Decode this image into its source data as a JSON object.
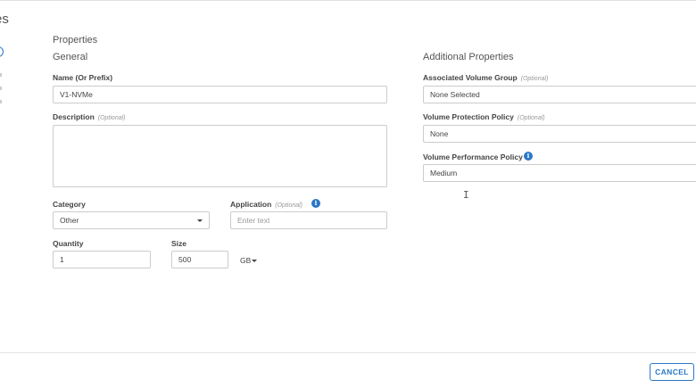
{
  "header": {
    "title_fragment": "es"
  },
  "properties": {
    "title": "Properties",
    "general": {
      "title": "General",
      "name_label": "Name (Or Prefix)",
      "name_value": "V1-NVMe",
      "description_label": "Description",
      "description_optional": "(Optional)",
      "category_label": "Category",
      "category_value": "Other",
      "application_label": "Application",
      "application_optional": "(Optional)",
      "application_placeholder": "Enter text",
      "quantity_label": "Quantity",
      "quantity_value": "1",
      "size_label": "Size",
      "size_value": "500",
      "size_unit": "GB"
    },
    "additional": {
      "title": "Additional Properties",
      "volume_group_label": "Associated Volume Group",
      "volume_group_optional": "(Optional)",
      "volume_group_value": "None Selected",
      "protection_label": "Volume Protection Policy",
      "protection_optional": "(Optional)",
      "protection_value": "None",
      "performance_label": "Volume Performance Policy",
      "performance_value": "Medium"
    }
  },
  "footer": {
    "cancel_label": "CANCEL"
  },
  "colors": {
    "accent": "#2a78c5",
    "border": "#cccccc",
    "text": "#444444"
  },
  "icons": {
    "info": "info-icon",
    "caret": "chevron-down-icon",
    "step": "step-indicator-icon",
    "cursor": "text-cursor-icon"
  }
}
